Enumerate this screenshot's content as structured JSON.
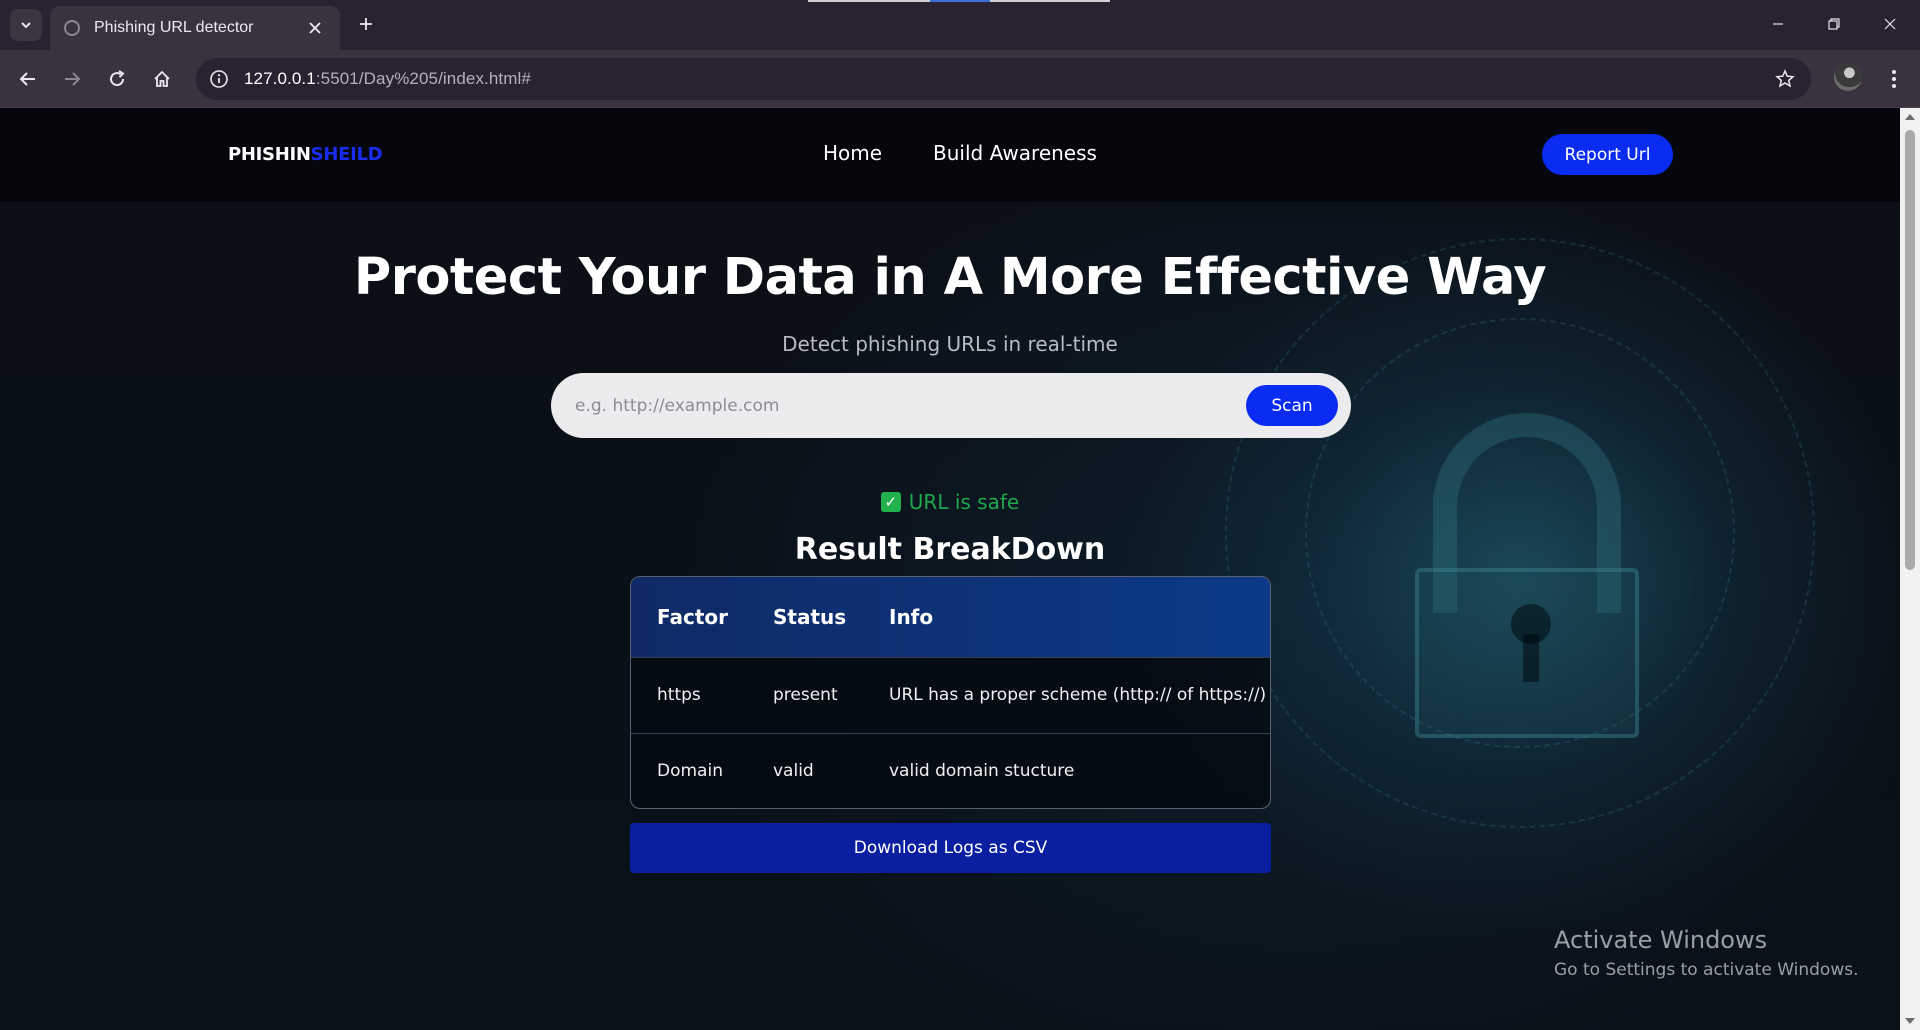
{
  "browser": {
    "tab_title": "Phishing URL detector",
    "url_host": "127.0.0.1",
    "url_rest": ":5501/Day%205/index.html#"
  },
  "nav": {
    "logo_main": "PHISHIN",
    "logo_accent": "SHEILD",
    "links": [
      "Home",
      "Build Awareness"
    ],
    "report_button": "Report Url"
  },
  "hero": {
    "title": "Protect Your Data in A More Effective Way",
    "subtitle": "Detect phishing URLs in real-time"
  },
  "search": {
    "placeholder": "e.g. http://example.com",
    "value": "",
    "scan_button": "Scan"
  },
  "result": {
    "status_text": "URL is safe",
    "status_color": "#1fa84a",
    "section_title": "Result BreakDown",
    "columns": [
      "Factor",
      "Status",
      "Info"
    ],
    "rows": [
      [
        "https",
        "present",
        "URL has a proper scheme (http:// of https://)"
      ],
      [
        "Domain",
        "valid",
        "valid domain stucture"
      ]
    ],
    "download_button": "Download Logs as CSV"
  },
  "watermark": {
    "title": "Activate Windows",
    "subtitle": "Go to Settings to activate Windows."
  },
  "colors": {
    "accent_blue": "#0a2cf2",
    "download_blue": "#0a1fa0",
    "table_header": "#0f2a66"
  }
}
